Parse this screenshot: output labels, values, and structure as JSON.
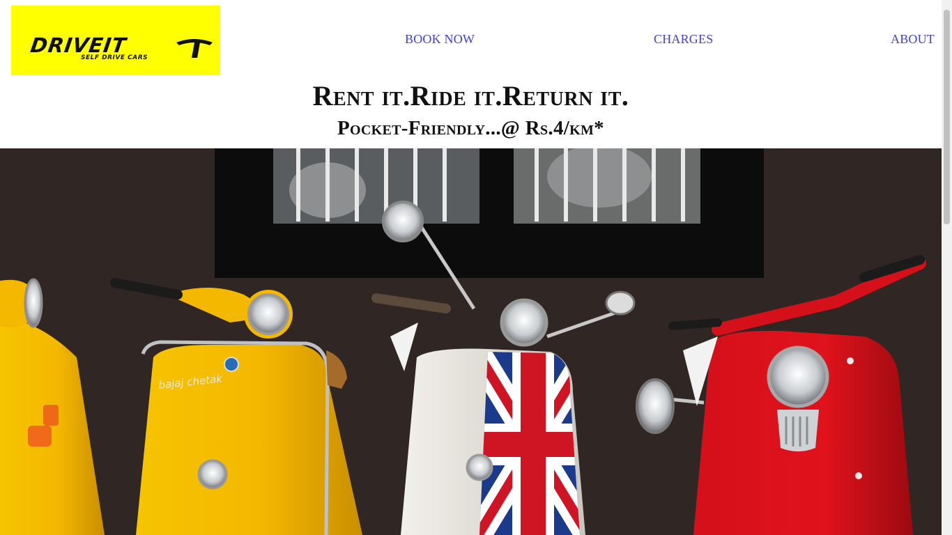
{
  "header": {
    "logo": {
      "brand": "DRIVEIT",
      "tagline": "SELF DRIVE CARS",
      "bg_color": "#ffff00"
    },
    "nav": {
      "book_now": "BOOK NOW",
      "charges": "CHARGES",
      "about": "ABOUT",
      "link_color": "#4040d8"
    }
  },
  "hero_text": {
    "headline": "Rent it.Ride it.Return it.",
    "subline": "Pocket-Friendly...@ Rs.4/km*"
  },
  "hero_image": {
    "alt_subject": "four vintage scooters in yellow, yellow, white with union jack, and red",
    "scooter_badge": "bajaj chetak"
  }
}
